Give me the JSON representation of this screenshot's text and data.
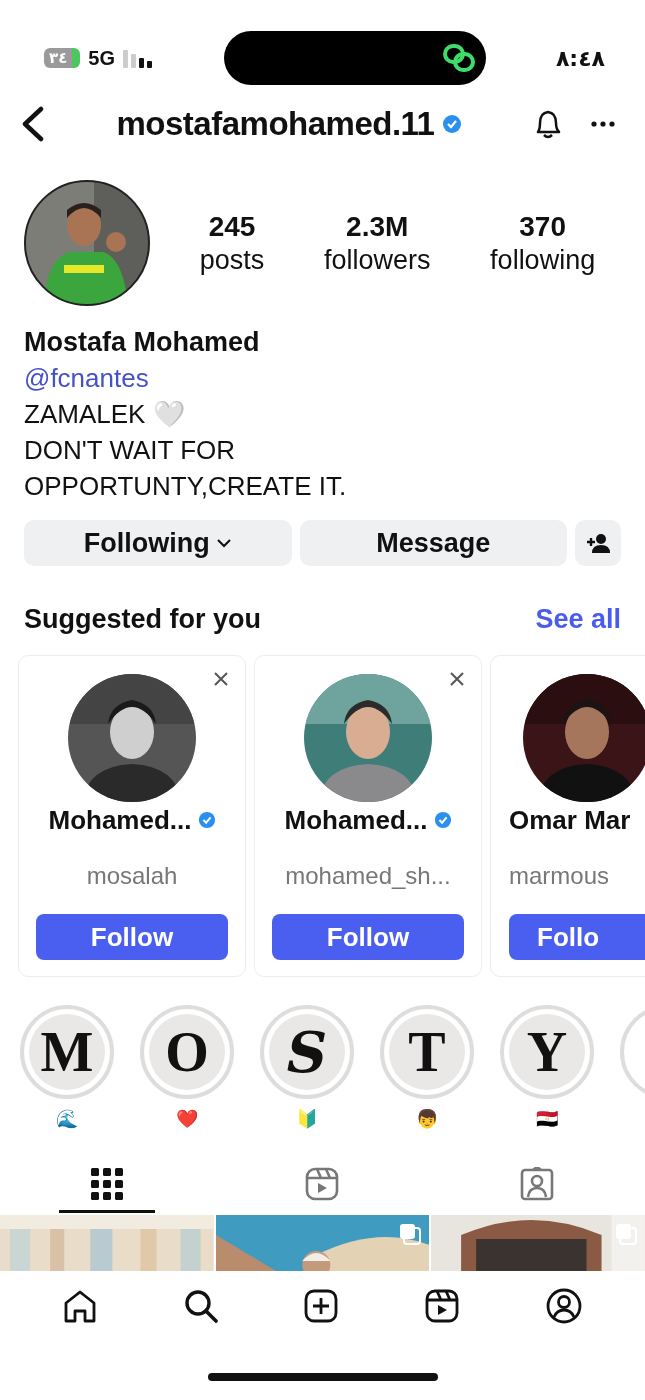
{
  "status_bar": {
    "battery": "٣٤",
    "network": "5G",
    "time": "٨:٤٨"
  },
  "header": {
    "username": "mostafamohamed.11",
    "verified": true
  },
  "profile": {
    "stats": [
      {
        "value": "245",
        "label": "posts"
      },
      {
        "value": "2.3M",
        "label": "followers"
      },
      {
        "value": "370",
        "label": "following"
      }
    ],
    "name": "Mostafa Mohamed",
    "link": "@fcnantes",
    "bio": [
      "ZAMALEK 🤍",
      "DON'T WAIT FOR",
      "OPPORTUNTY,CREATE IT."
    ]
  },
  "actions": [
    {
      "kind": "dropdown",
      "label": "Following"
    },
    {
      "kind": "plain",
      "label": "Message"
    },
    {
      "kind": "add-person"
    }
  ],
  "suggested": {
    "title": "Suggested for you",
    "link": "See all",
    "cards": [
      {
        "name": "Mohamed...",
        "verified": true,
        "username": "mosalah",
        "button": "Follow",
        "dismissible": true
      },
      {
        "name": "Mohamed...",
        "verified": true,
        "username": "mohamed_sh...",
        "button": "Follow",
        "dismissible": true
      },
      {
        "name": "Omar Mar",
        "verified": false,
        "username": "marmous",
        "button": "Follo",
        "dismissible": false
      }
    ]
  },
  "highlights": [
    {
      "kind": "letter",
      "cover": "M",
      "label": "🌊"
    },
    {
      "kind": "letter",
      "cover": "O",
      "label": "❤️"
    },
    {
      "kind": "snake",
      "cover": "S",
      "label": "🔰"
    },
    {
      "kind": "letter",
      "cover": "T",
      "label": "👦"
    },
    {
      "kind": "letter",
      "cover": "Y",
      "label": "🇪🇬"
    },
    {
      "kind": "blank"
    }
  ],
  "tabs": [
    {
      "kind": "grid",
      "selected": true
    },
    {
      "kind": "reels",
      "selected": false
    },
    {
      "kind": "tagged",
      "selected": false
    }
  ],
  "posts": [
    {
      "multiple": false
    },
    {
      "multiple": true
    },
    {
      "multiple": true
    }
  ],
  "nav": [
    {
      "kind": "home"
    },
    {
      "kind": "search"
    },
    {
      "kind": "create"
    },
    {
      "kind": "reels"
    },
    {
      "kind": "profile"
    }
  ]
}
